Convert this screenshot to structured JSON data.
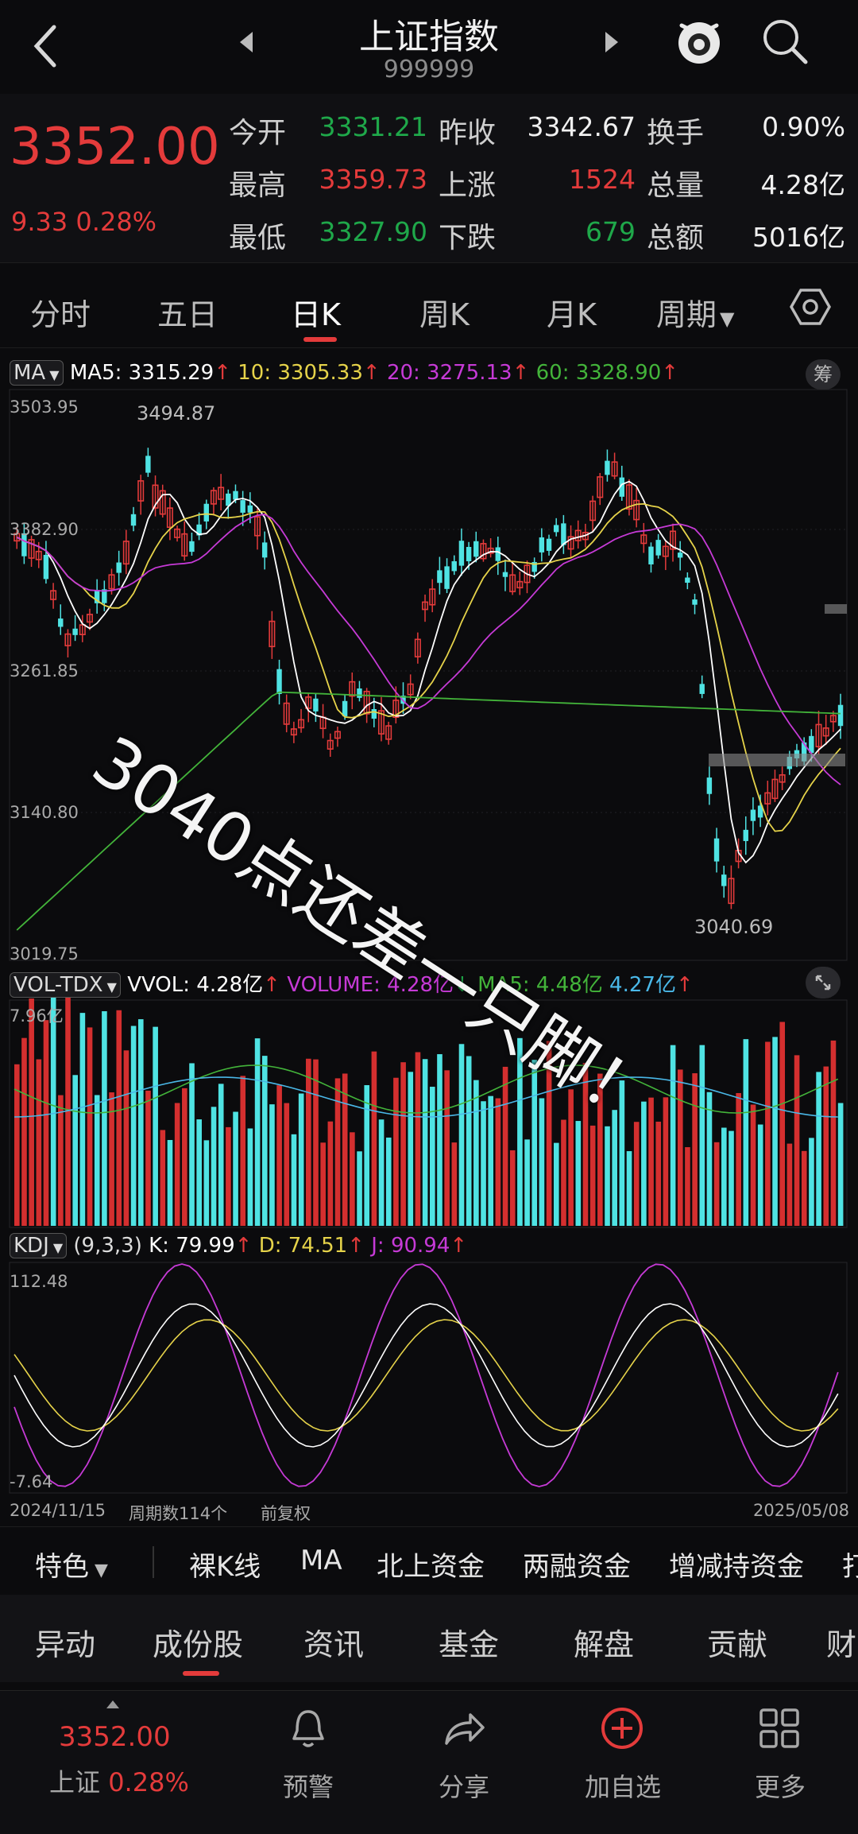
{
  "header": {
    "title": "上证指数",
    "code": "999999",
    "icons": [
      "back-icon",
      "prev-icon",
      "next-icon",
      "mascot-icon",
      "search-icon"
    ]
  },
  "quote": {
    "price": "3352.00",
    "change": "9.33  0.28%",
    "rows": [
      {
        "l1": "今开",
        "v1": "3331.21",
        "l2": "昨收",
        "v2": "3342.67",
        "l3": "换手",
        "v3": "0.90%"
      },
      {
        "l1": "最高",
        "v1": "3359.73",
        "l2": "上涨",
        "v2": "1524",
        "l3": "总量",
        "v3": "4.28亿"
      },
      {
        "l1": "最低",
        "v1": "3327.90",
        "l2": "下跌",
        "v2": "679",
        "l3": "总额",
        "v3": "5016亿"
      }
    ]
  },
  "tabs": {
    "items": [
      "分时",
      "五日",
      "日K",
      "周K",
      "月K",
      "周期"
    ],
    "active": "日K"
  },
  "kline": {
    "ma_tag": "MA",
    "ma5": "MA5: 3315.29",
    "ma10": "10: 3305.33",
    "ma20": "20: 3275.13",
    "ma60": "60: 3328.90",
    "fq": "筹",
    "y_top": "3503.95",
    "y_2": "3382.90",
    "y_3": "3261.85",
    "y_4": "3140.80",
    "y_bottom": "3019.75",
    "high_label": "3494.87",
    "low_label": "3040.69"
  },
  "vol": {
    "tag": "VOL-TDX",
    "vvol": "VVOL: 4.28亿",
    "volume": "VOLUME: 4.28亿",
    "ma5": "MA5: 4.48亿",
    "ma10": "4.27亿",
    "y_top": "7.96亿"
  },
  "kdj": {
    "tag": "KDJ",
    "params": "(9,3,3)",
    "k": "K: 79.99",
    "d": "D: 74.51",
    "j": "J: 90.94",
    "y_top": "112.48",
    "y_bottom": "-7.64",
    "date_start": "2024/11/15",
    "periods": "周期数114个",
    "adjust": "前复权",
    "date_end": "2025/05/08"
  },
  "watermark": "3040点还差一只脚！",
  "features": {
    "menu": "特色",
    "items": [
      "裸K线",
      "MA",
      "北上资金",
      "两融资金",
      "增减持资金",
      "打"
    ],
    "active": "MA"
  },
  "subtabs": {
    "items": [
      "异动",
      "成份股",
      "资讯",
      "基金",
      "解盘",
      "贡献",
      "财"
    ],
    "active": "成份股"
  },
  "bottom": {
    "price": "3352.00",
    "name": "上证",
    "pct": "0.28%",
    "nav": [
      "预警",
      "分享",
      "加自选",
      "更多"
    ]
  },
  "colors": {
    "up": "#e43b3b",
    "down": "#4fe3e3",
    "ma5": "#ffffff",
    "ma10": "#e6d34a",
    "ma20": "#c63ad6",
    "ma60": "#43b43a",
    "accent": "#e43b3b"
  }
}
